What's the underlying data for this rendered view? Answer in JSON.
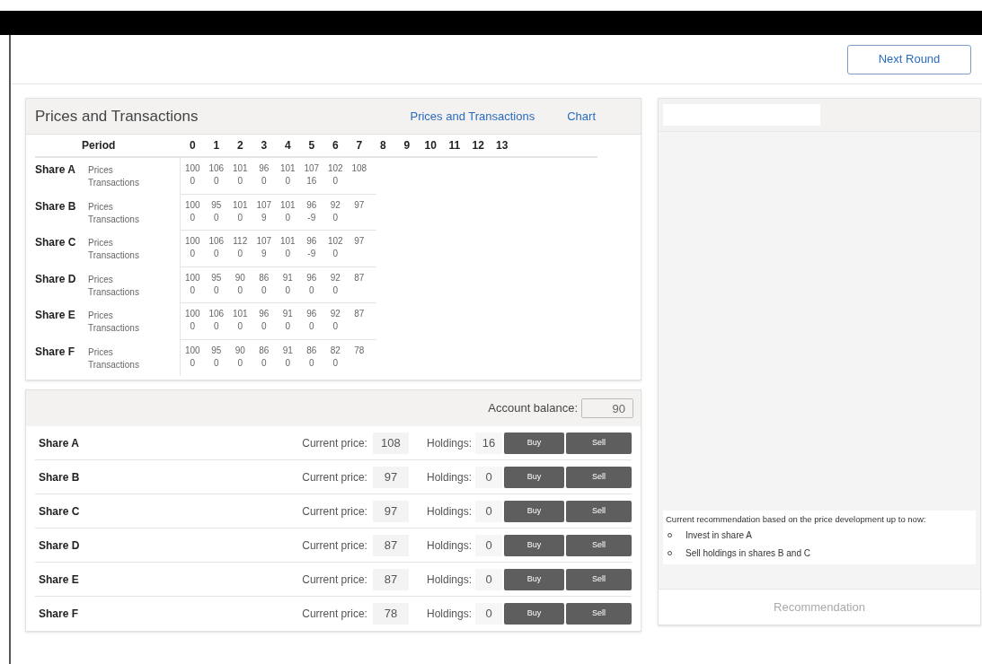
{
  "next_button": "Next Round",
  "prices_panel": {
    "title": "Prices and Transactions",
    "links": [
      "Prices and Transactions",
      "Chart"
    ],
    "period_label": "Period",
    "periods": [
      "0",
      "1",
      "2",
      "3",
      "4",
      "5",
      "6",
      "7",
      "8",
      "9",
      "10",
      "11",
      "12",
      "13"
    ],
    "shares": [
      {
        "name": "Share A",
        "price_label": "Prices",
        "transaction_label": "Transactions",
        "prices": [
          "100",
          "106",
          "101",
          "96",
          "101",
          "107",
          "102",
          "108"
        ],
        "transactions": [
          "0",
          "0",
          "0",
          "0",
          "0",
          "16",
          "0"
        ]
      },
      {
        "name": "Share B",
        "price_label": "Prices",
        "transaction_label": "Transactions",
        "prices": [
          "100",
          "95",
          "101",
          "107",
          "101",
          "96",
          "92",
          "97"
        ],
        "transactions": [
          "0",
          "0",
          "0",
          "9",
          "0",
          "-9",
          "0"
        ]
      },
      {
        "name": "Share C",
        "price_label": "Prices",
        "transaction_label": "Transactions",
        "prices": [
          "100",
          "106",
          "112",
          "107",
          "101",
          "96",
          "102",
          "97"
        ],
        "transactions": [
          "0",
          "0",
          "0",
          "9",
          "0",
          "-9",
          "0"
        ]
      },
      {
        "name": "Share D",
        "price_label": "Prices",
        "transaction_label": "Transactions",
        "prices": [
          "100",
          "95",
          "90",
          "86",
          "91",
          "96",
          "92",
          "87"
        ],
        "transactions": [
          "0",
          "0",
          "0",
          "0",
          "0",
          "0",
          "0"
        ]
      },
      {
        "name": "Share E",
        "price_label": "Prices",
        "transaction_label": "Transactions",
        "prices": [
          "100",
          "106",
          "101",
          "96",
          "91",
          "96",
          "92",
          "87"
        ],
        "transactions": [
          "0",
          "0",
          "0",
          "0",
          "0",
          "0",
          "0"
        ]
      },
      {
        "name": "Share F",
        "price_label": "Prices",
        "transaction_label": "Transactions",
        "prices": [
          "100",
          "95",
          "90",
          "86",
          "91",
          "86",
          "82",
          "78"
        ],
        "transactions": [
          "0",
          "0",
          "0",
          "0",
          "0",
          "0",
          "0"
        ]
      }
    ]
  },
  "trade_panel": {
    "balance_label": "Account balance:",
    "balance": "90",
    "rows": [
      {
        "name": "Share A",
        "price_label": "Current price:",
        "price": "108",
        "holdings_label": "Holdings:",
        "holdings": "16",
        "buy": "Buy",
        "sell": "Sell"
      },
      {
        "name": "Share B",
        "price_label": "Current price:",
        "price": "97",
        "holdings_label": "Holdings:",
        "holdings": "0",
        "buy": "Buy",
        "sell": "Sell"
      },
      {
        "name": "Share C",
        "price_label": "Current price:",
        "price": "97",
        "holdings_label": "Holdings:",
        "holdings": "0",
        "buy": "Buy",
        "sell": "Sell"
      },
      {
        "name": "Share D",
        "price_label": "Current price:",
        "price": "87",
        "holdings_label": "Holdings:",
        "holdings": "0",
        "buy": "Buy",
        "sell": "Sell"
      },
      {
        "name": "Share E",
        "price_label": "Current price:",
        "price": "87",
        "holdings_label": "Holdings:",
        "holdings": "0",
        "buy": "Buy",
        "sell": "Sell"
      },
      {
        "name": "Share F",
        "price_label": "Current price:",
        "price": "78",
        "holdings_label": "Holdings:",
        "holdings": "0",
        "buy": "Buy",
        "sell": "Sell"
      }
    ]
  },
  "recommendation_panel": {
    "intro": "Current recommendation based on the price development up to now:",
    "items": [
      "Invest in share A",
      "Sell holdings in shares B and C"
    ],
    "button": "Recommendation"
  }
}
